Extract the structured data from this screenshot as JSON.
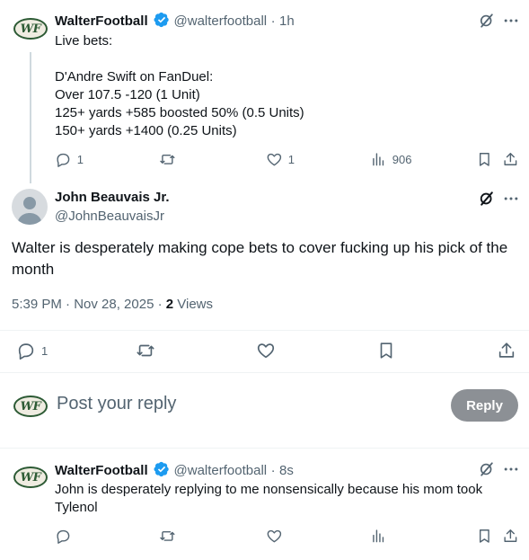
{
  "tweet1": {
    "author_name": "WalterFootball",
    "handle": "@walterfootball",
    "time": "1h",
    "text": "Live bets:\n\nD'Andre Swift on FanDuel:\nOver 107.5 -120 (1 Unit)\n125+ yards +585 boosted 50% (0.5 Units)\n150+ yards +1400 (0.25 Units)",
    "replies": "1",
    "likes": "1",
    "views": "906"
  },
  "focus_tweet": {
    "author_name": "John Beauvais Jr.",
    "handle": "@JohnBeauvaisJr",
    "text": "Walter is desperately making cope bets to cover fucking up his pick of the month",
    "timestamp": "5:39 PM · Nov 28, 2025 · ",
    "views_count": "2",
    "views_label": " Views",
    "replies": "1"
  },
  "composer": {
    "placeholder": "Post your reply",
    "reply_label": "Reply"
  },
  "tweet3": {
    "author_name": "WalterFootball",
    "handle": "@walterfootball",
    "time": "8s",
    "text": "John is desperately replying to me nonsensically because his mom took Tylenol"
  },
  "logo_text": "WF",
  "colors": {
    "verified": "#1d9bf0",
    "logo_green": "#2c5a34",
    "muted": "#536471",
    "reply_button": "#8c9095"
  }
}
